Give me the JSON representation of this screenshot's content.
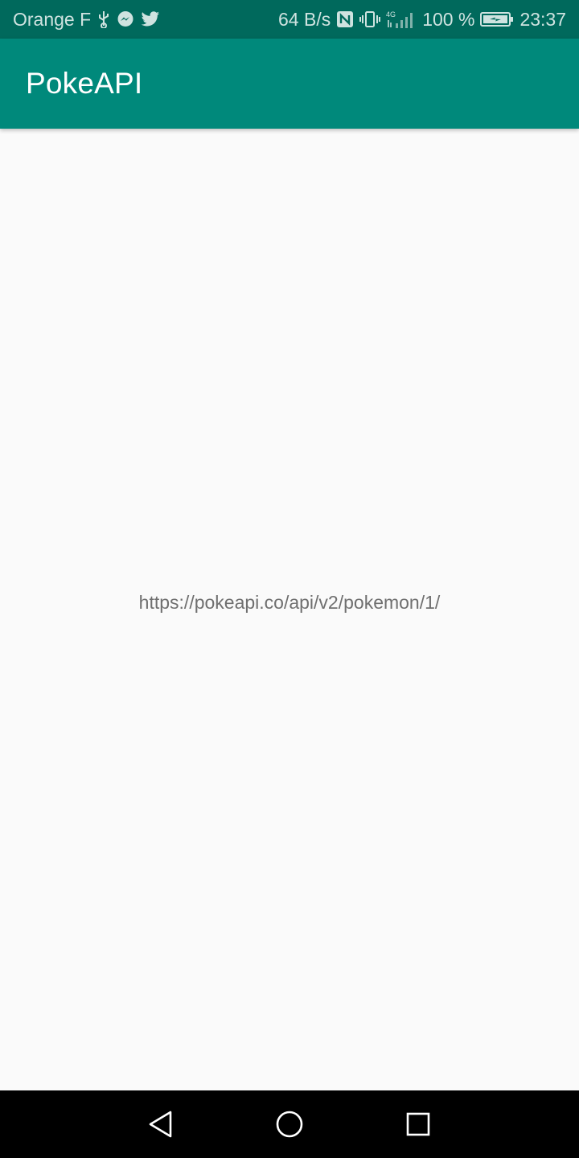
{
  "status_bar": {
    "carrier": "Orange F",
    "net_speed": "64 B/s",
    "network_type": "4G",
    "battery": "100 %",
    "time": "23:37",
    "icons": [
      "usb-icon",
      "messenger-icon",
      "twitter-icon",
      "nfc-icon",
      "vibrate-icon",
      "signal-icon",
      "battery-icon"
    ]
  },
  "app_bar": {
    "title": "PokeAPI"
  },
  "main": {
    "url": "https://pokeapi.co/api/v2/pokemon/1/"
  },
  "nav_bar": {
    "buttons": [
      "back-button",
      "home-button",
      "recents-button"
    ]
  },
  "colors": {
    "status_bar": "#00695c",
    "app_bar": "#00897b",
    "background": "#fafafa",
    "nav_bar": "#000000"
  }
}
